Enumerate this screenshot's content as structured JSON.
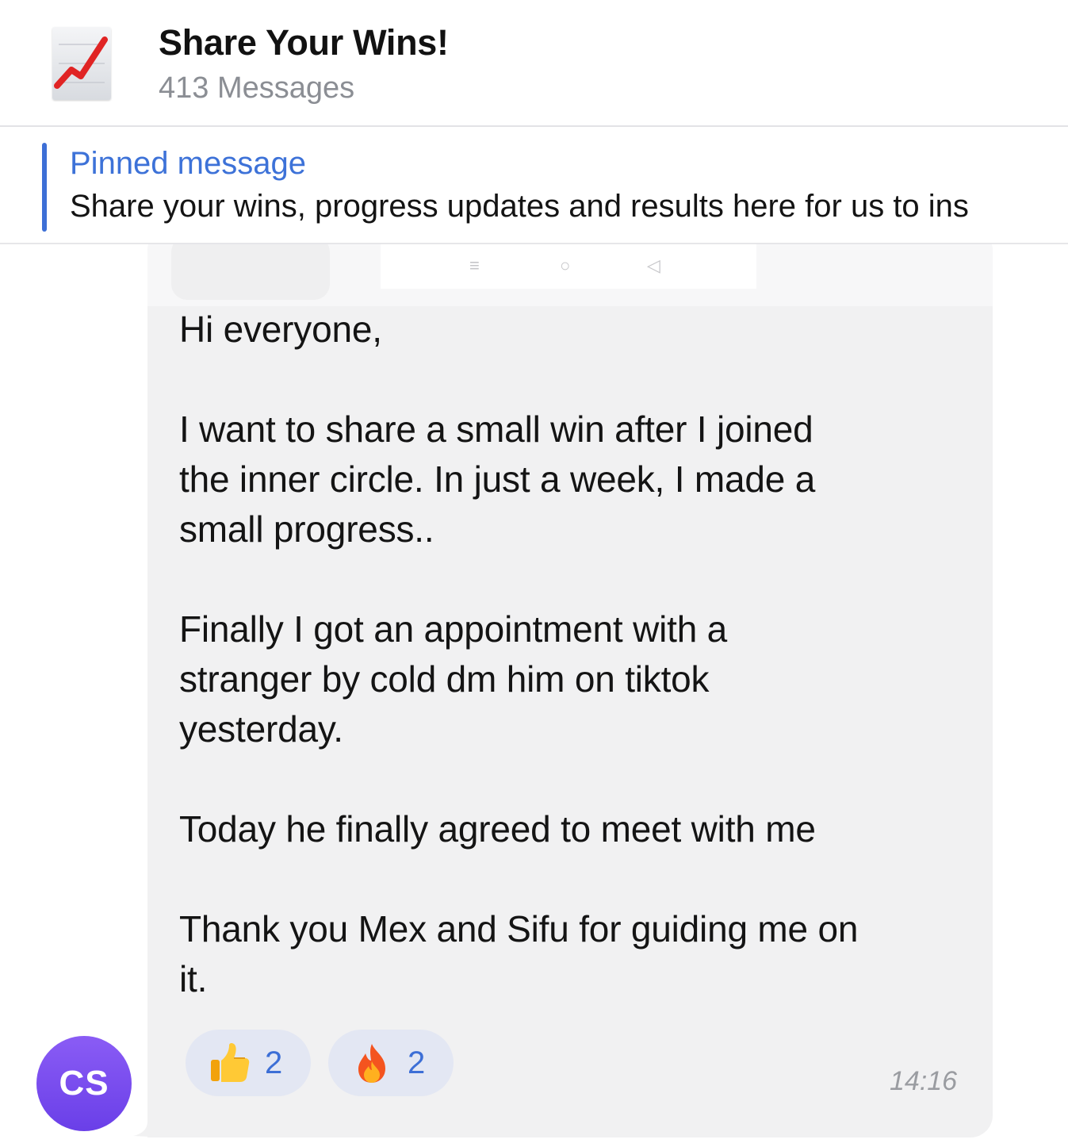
{
  "header": {
    "icon": "chart-increasing-icon",
    "title": "Share Your Wins!",
    "subtitle": "413 Messages"
  },
  "pinned": {
    "label": "Pinned message",
    "text": "Share your wins, progress updates and results here for us to ins"
  },
  "message": {
    "author_initials": "CS",
    "text": "Hi everyone,\n\nI want to share a small win after I joined\nthe inner circle. In just a week, I made a\nsmall progress..\n\nFinally I got an appointment with a\nstranger by cold dm him on tiktok\nyesterday.\n\nToday he finally agreed to meet with me\n\nThank you Mex and Sifu for guiding me on\nit.",
    "time": "14:16",
    "reactions": [
      {
        "emoji": "thumbs-up-icon",
        "count": "2"
      },
      {
        "emoji": "fire-icon",
        "count": "2"
      }
    ]
  },
  "image_nav": {
    "menu_glyph": "≡",
    "home_glyph": "○",
    "back_glyph": "◁"
  },
  "colors": {
    "accent": "#3d6fd6",
    "bubble": "#f1f1f2",
    "reaction_bg": "#e3e7f3",
    "avatar": "#7c4ff0"
  }
}
